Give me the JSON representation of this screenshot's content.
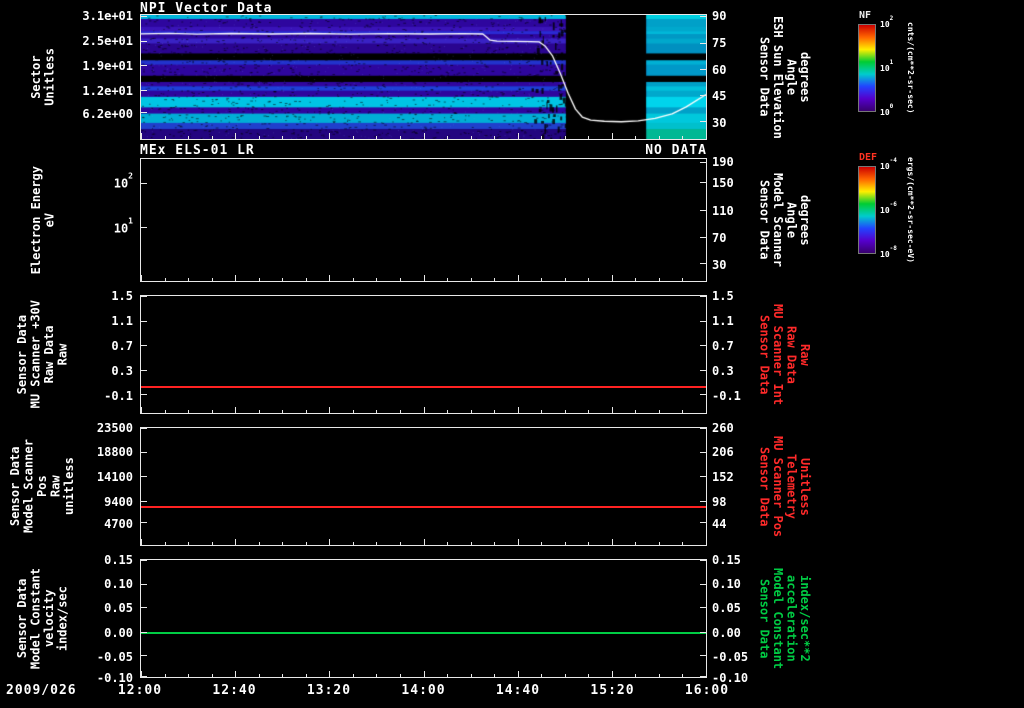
{
  "header": {
    "title": "NPI Vector Data"
  },
  "xaxis": {
    "date": "2009/026",
    "ticks": [
      "12:00",
      "12:40",
      "13:20",
      "14:00",
      "14:40",
      "15:20",
      "16:00"
    ]
  },
  "panels": [
    {
      "name": "npi-spectrogram",
      "left_label": "Sector\nUnitless",
      "left_ticks": [
        {
          "t": "3.1e+01",
          "f": 0.016
        },
        {
          "t": "2.5e+01",
          "f": 0.214
        },
        {
          "t": "1.9e+01",
          "f": 0.413
        },
        {
          "t": "1.2e+01",
          "f": 0.611
        },
        {
          "t": "6.2e+00",
          "f": 0.79
        }
      ],
      "right_ticks": [
        {
          "t": "90",
          "f": 0.016
        },
        {
          "t": "75",
          "f": 0.23
        },
        {
          "t": "60",
          "f": 0.444
        },
        {
          "t": "45",
          "f": 0.65
        },
        {
          "t": "30",
          "f": 0.865
        }
      ],
      "right_label": "Sensor Data\nESH Sun Elevation\nAngle\ndegrees",
      "right_label_color": "#ffffff"
    },
    {
      "name": "els-spectrogram",
      "title": "MEx ELS-01 LR",
      "status": "NO DATA",
      "left_label": "Electron Energy\neV",
      "left_ticks": [
        {
          "t": "10",
          "sup": "2",
          "f": 0.202
        },
        {
          "t": "10",
          "sup": "1",
          "f": 0.565
        }
      ],
      "right_ticks": [
        {
          "t": "190",
          "f": 0.03
        },
        {
          "t": "150",
          "f": 0.2
        },
        {
          "t": "110",
          "f": 0.43
        },
        {
          "t": "70",
          "f": 0.645
        },
        {
          "t": "30",
          "f": 0.863
        }
      ],
      "right_label": "Sensor Data\nModel Scanner\nAngle\ndegrees",
      "right_label_color": "#ffffff"
    },
    {
      "name": "mu-scanner-30v",
      "left_label": "Sensor Data\nMU Scanner +30V\nRaw Data\nRaw",
      "left_ticks": [
        {
          "t": "1.5",
          "f": 0.008
        },
        {
          "t": "1.1",
          "f": 0.218
        },
        {
          "t": "0.7",
          "f": 0.428
        },
        {
          "t": "0.3",
          "f": 0.639
        },
        {
          "t": "-0.1",
          "f": 0.849
        }
      ],
      "right_ticks": [
        {
          "t": "1.5",
          "f": 0.008
        },
        {
          "t": "1.1",
          "f": 0.218
        },
        {
          "t": "0.7",
          "f": 0.428
        },
        {
          "t": "0.3",
          "f": 0.639
        },
        {
          "t": "-0.1",
          "f": 0.849
        }
      ],
      "right_label": "Sensor Data\nMU Scanner Int\nRaw Data\nRaw",
      "right_label_color": "#ff2a2a",
      "line": {
        "color": "#ff2222",
        "f": 0.78,
        "value": 0.0
      }
    },
    {
      "name": "model-scanner-pos",
      "left_label": "Sensor Data\nModel Scanner Pos\nRaw\nunitless",
      "left_ticks": [
        {
          "t": "23500",
          "f": 0.008
        },
        {
          "t": "18800",
          "f": 0.21
        },
        {
          "t": "14100",
          "f": 0.42
        },
        {
          "t": "9400",
          "f": 0.63
        },
        {
          "t": "4700",
          "f": 0.815
        }
      ],
      "right_ticks": [
        {
          "t": "260",
          "f": 0.008
        },
        {
          "t": "206",
          "f": 0.21
        },
        {
          "t": "152",
          "f": 0.42
        },
        {
          "t": "98",
          "f": 0.63
        },
        {
          "t": "44",
          "f": 0.815
        }
      ],
      "right_label": "Sensor Data\nMU Scanner Pos\nTelemetry\nUnitless",
      "right_label_color": "#ff2a2a",
      "line": {
        "color": "#ff2222",
        "f": 0.677,
        "value": 8200
      }
    },
    {
      "name": "model-constant",
      "left_label": "Sensor Data\nModel Constant\nvelocity\nindex/sec",
      "left_ticks": [
        {
          "t": "0.15",
          "f": 0.008
        },
        {
          "t": "0.10",
          "f": 0.21
        },
        {
          "t": "0.05",
          "f": 0.412
        },
        {
          "t": "0.00",
          "f": 0.62
        },
        {
          "t": "-0.05",
          "f": 0.824
        },
        {
          "t": "-0.10",
          "f": 1.0
        }
      ],
      "right_ticks": [
        {
          "t": "0.15",
          "f": 0.008
        },
        {
          "t": "0.10",
          "f": 0.21
        },
        {
          "t": "0.05",
          "f": 0.412
        },
        {
          "t": "0.00",
          "f": 0.62
        },
        {
          "t": "-0.05",
          "f": 0.824
        },
        {
          "t": "-0.10",
          "f": 1.0
        }
      ],
      "right_label": "Sensor Data\nModel Constant\nacceleration\nindex/sec**2",
      "right_label_color": "#00cc44",
      "line": {
        "color": "#00cc44",
        "f": 0.62,
        "value": 0.0
      }
    }
  ],
  "colorbars": [
    {
      "name": "NF",
      "title_color": "#eeeeee",
      "units": "cnts/(cm**2-sr-sec)",
      "ticks": [
        {
          "t": "10",
          "sup": "2",
          "f": 0.0
        },
        {
          "t": "10",
          "sup": "1",
          "f": 0.5
        },
        {
          "t": "10",
          "sup": "0",
          "f": 1.0
        }
      ],
      "gradient": [
        "#cc0000",
        "#ff6600",
        "#ffee00",
        "#00cc33",
        "#00cccc",
        "#2244ff",
        "#5500cc",
        "#38006e"
      ]
    },
    {
      "name": "DEF",
      "title_color": "#ff3322",
      "units": "ergs/(cm**2-sr-sec-eV)",
      "ticks": [
        {
          "t": "10",
          "sup": "-4",
          "f": 0.0
        },
        {
          "t": "10",
          "sup": "-6",
          "f": 0.5
        },
        {
          "t": "10",
          "sup": "-8",
          "f": 1.0
        }
      ],
      "gradient": [
        "#cc0000",
        "#ff6600",
        "#ffee00",
        "#00cc33",
        "#00cccc",
        "#2244ff",
        "#5500cc",
        "#38006e"
      ]
    }
  ],
  "chart_data": [
    {
      "type": "heatmap",
      "title": "NPI Vector Data",
      "ylabel": "Sector Unitless",
      "y_tick_labels": [
        "3.1e+01",
        "2.5e+01",
        "1.9e+01",
        "1.2e+01",
        "6.2e+00"
      ],
      "x_range": [
        "12:00",
        "16:00"
      ],
      "x_date": "2009/026",
      "right_axis": {
        "label": "Sensor Data ESH Sun Elevation Angle degrees",
        "ticks": [
          90,
          75,
          60,
          45,
          30
        ]
      },
      "colorbar": {
        "title": "NF",
        "units": "cnts/(cm**2-sr-sec)",
        "scale": [
          "10^2",
          "10^1",
          "10^0"
        ]
      },
      "data_gap_x": [
        0.752,
        0.894
      ],
      "rows": [
        {
          "y0": 0.0,
          "y1": 0.032,
          "pre": "#00b8dc",
          "post": "#00d0e0"
        },
        {
          "y0": 0.032,
          "y1": 0.095,
          "pre": "#2e069e",
          "post": "#00a0c8"
        },
        {
          "y0": 0.095,
          "y1": 0.13,
          "pre": "#3a13b8",
          "post": "#00a8cc"
        },
        {
          "y0": 0.13,
          "y1": 0.155,
          "pre": "#2a2ad4",
          "post": "#00b8d8"
        },
        {
          "y0": 0.155,
          "y1": 0.19,
          "pre": "#2e069e",
          "post": "#0098c4"
        },
        {
          "y0": 0.19,
          "y1": 0.23,
          "pre": "#3922c4",
          "post": "#00a8cc"
        },
        {
          "y0": 0.23,
          "y1": 0.31,
          "pre": "#2a0590",
          "post": "#0090c0"
        },
        {
          "y0": 0.31,
          "y1": 0.365,
          "pre": "#000000",
          "post": "#000000"
        },
        {
          "y0": 0.365,
          "y1": 0.4,
          "pre": "#2233cc",
          "post": "#00b0d4"
        },
        {
          "y0": 0.4,
          "y1": 0.49,
          "pre": "#2e069e",
          "post": "#0098c8"
        },
        {
          "y0": 0.49,
          "y1": 0.54,
          "pre": "#000000",
          "post": "#000000"
        },
        {
          "y0": 0.54,
          "y1": 0.575,
          "pre": "#30079f",
          "post": "#00a0c8"
        },
        {
          "y0": 0.575,
          "y1": 0.61,
          "pre": "#1e40d8",
          "post": "#00c0dc"
        },
        {
          "y0": 0.61,
          "y1": 0.66,
          "pre": "#2e069e",
          "post": "#00a8cc"
        },
        {
          "y0": 0.66,
          "y1": 0.745,
          "pre": "#00c4e4",
          "post": "#00d4ec"
        },
        {
          "y0": 0.745,
          "y1": 0.795,
          "pre": "#2e069e",
          "post": "#00a0c8"
        },
        {
          "y0": 0.795,
          "y1": 0.87,
          "pre": "#00aed6",
          "post": "#00c8dc"
        },
        {
          "y0": 0.87,
          "y1": 0.92,
          "pre": "#2040cc",
          "post": "#00c0cc"
        },
        {
          "y0": 0.92,
          "y1": 1.0,
          "pre": "#23057f",
          "post": "#00b894"
        }
      ],
      "sun_line": [
        [
          0.0,
          80.4
        ],
        [
          0.05,
          80.7
        ],
        [
          0.1,
          80.2
        ],
        [
          0.16,
          80.6
        ],
        [
          0.23,
          80.3
        ],
        [
          0.3,
          80.6
        ],
        [
          0.37,
          80.2
        ],
        [
          0.44,
          80.5
        ],
        [
          0.51,
          80.3
        ],
        [
          0.57,
          80.5
        ],
        [
          0.605,
          80.3
        ],
        [
          0.612,
          78.5
        ],
        [
          0.618,
          76.8
        ],
        [
          0.63,
          76.3
        ],
        [
          0.66,
          76.1
        ],
        [
          0.69,
          76.0
        ],
        [
          0.705,
          75.8
        ],
        [
          0.715,
          73.5
        ],
        [
          0.728,
          68.0
        ],
        [
          0.742,
          58.0
        ],
        [
          0.756,
          46.5
        ],
        [
          0.769,
          37.5
        ],
        [
          0.781,
          33.0
        ],
        [
          0.796,
          31.2
        ],
        [
          0.82,
          30.6
        ],
        [
          0.85,
          30.3
        ],
        [
          0.88,
          30.8
        ],
        [
          0.91,
          32.2
        ],
        [
          0.94,
          34.8
        ],
        [
          0.965,
          38.8
        ],
        [
          1.0,
          45.8
        ]
      ]
    },
    {
      "type": "heatmap",
      "title": "MEx ELS-01 LR",
      "status": "NO DATA",
      "ylabel": "Electron Energy eV",
      "y_tick_labels": [
        "10^2",
        "10^1"
      ],
      "x_range": [
        "12:00",
        "16:00"
      ],
      "right_axis": {
        "label": "Sensor Data Model Scanner Angle degrees",
        "ticks": [
          190,
          150,
          110,
          70,
          30
        ]
      },
      "colorbar": {
        "title": "DEF",
        "units": "ergs/(cm**2-sr-sec-eV)",
        "scale": [
          "10^-4",
          "10^-6",
          "10^-8"
        ]
      },
      "values": []
    },
    {
      "type": "line",
      "ylabel": "Sensor Data MU Scanner +30V Raw Data Raw",
      "y_ticks": [
        1.5,
        1.1,
        0.7,
        0.3,
        -0.1
      ],
      "x_range": [
        "12:00",
        "16:00"
      ],
      "series": [
        {
          "name": "Sensor Data MU Scanner Int Raw Data Raw",
          "color": "#ff2222",
          "constant_value": 0.0
        }
      ]
    },
    {
      "type": "line",
      "ylabel": "Sensor Data Model Scanner Pos Raw unitless",
      "y_ticks": [
        23500,
        18800,
        14100,
        9400,
        4700
      ],
      "right_axis": {
        "label": "Sensor Data MU Scanner Pos Telemetry Unitless",
        "ticks": [
          260,
          206,
          152,
          98,
          44
        ]
      },
      "x_range": [
        "12:00",
        "16:00"
      ],
      "series": [
        {
          "name": "Sensor Data Model Scanner Pos Raw",
          "color": "#ff2222",
          "constant_value": 8200
        }
      ]
    },
    {
      "type": "line",
      "ylabel": "Sensor Data Model Constant velocity index/sec",
      "y_ticks": [
        0.15,
        0.1,
        0.05,
        0.0,
        -0.05,
        -0.1
      ],
      "right_axis": {
        "label": "Sensor Data Model Constant acceleration index/sec**2",
        "ticks": [
          0.15,
          0.1,
          0.05,
          0.0,
          -0.05,
          -0.1
        ]
      },
      "x_range": [
        "12:00",
        "16:00"
      ],
      "series": [
        {
          "name": "Sensor Data Model Constant velocity",
          "color": "#00cc44",
          "constant_value": 0.0
        }
      ]
    }
  ]
}
